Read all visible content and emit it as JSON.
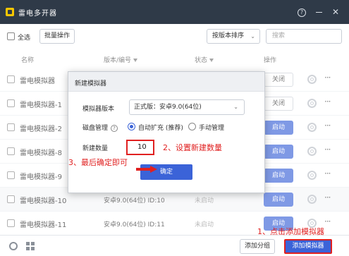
{
  "window": {
    "title": "雷电多开器"
  },
  "toolbar": {
    "select_all": "全选",
    "batch": "批量操作",
    "sort": "按版本排序",
    "search_placeholder": "搜索"
  },
  "columns": {
    "name": "名称",
    "version": "版本/编号",
    "status": "状态",
    "operation": "操作"
  },
  "rows": [
    {
      "name": "雷电模拟器",
      "version": "",
      "status": "",
      "action": "关闭",
      "action_type": "stop"
    },
    {
      "name": "雷电模拟器-1",
      "version": "",
      "status": "",
      "action": "关闭",
      "action_type": "stop"
    },
    {
      "name": "雷电模拟器-2",
      "version": "",
      "status": "",
      "action": "启动",
      "action_type": "start"
    },
    {
      "name": "雷电模拟器-8",
      "version": "",
      "status": "",
      "action": "启动",
      "action_type": "start"
    },
    {
      "name": "雷电模拟器-9",
      "version": "",
      "status": "",
      "action": "启动",
      "action_type": "start"
    },
    {
      "name": "雷电模拟器-10",
      "version": "安卓9.0(64位)  ID:10",
      "status": "未启动",
      "action": "启动",
      "action_type": "start"
    },
    {
      "name": "雷电模拟器-11",
      "version": "安卓9.0(64位)  ID:11",
      "status": "未启动",
      "action": "启动",
      "action_type": "start"
    }
  ],
  "bottom": {
    "add_group": "添加分组",
    "add_emulator": "添加模拟器"
  },
  "dialog": {
    "title": "新建模拟器",
    "version_label": "模拟器版本",
    "version_value": "正式版：安卓9.0(64位)",
    "disk_label": "磁盘管理",
    "disk_options": [
      "自动扩充 (推荐)",
      "手动管理"
    ],
    "count_label": "新建数量",
    "count_value": "10",
    "confirm": "确定"
  },
  "annotations": {
    "step1": "1、点击添加模拟器",
    "step2": "2、设置新建数量",
    "step3": "3、最后确定即可"
  },
  "colors": {
    "accent": "#3b63d8",
    "annotation": "#e02020",
    "titlebar": "#2f3a48"
  }
}
